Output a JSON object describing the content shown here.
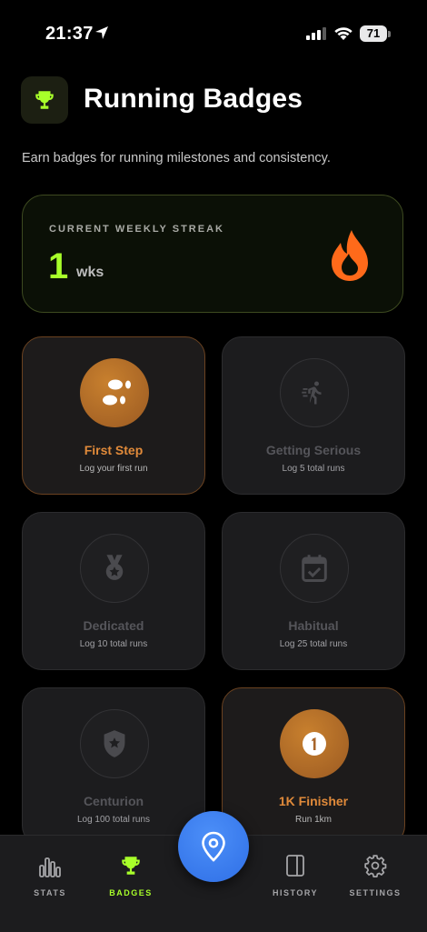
{
  "status_bar": {
    "time": "21:37",
    "battery": "71"
  },
  "header": {
    "title": "Running Badges",
    "subtitle": "Earn badges for running milestones and consistency."
  },
  "streak": {
    "label": "CURRENT WEEKLY STREAK",
    "value": "1",
    "unit": "wks"
  },
  "badges": [
    {
      "name": "First Step",
      "desc": "Log your first run",
      "earned": true,
      "icon": "footprints-icon"
    },
    {
      "name": "Getting Serious",
      "desc": "Log 5 total runs",
      "earned": false,
      "icon": "runner-icon"
    },
    {
      "name": "Dedicated",
      "desc": "Log 10 total runs",
      "earned": false,
      "icon": "medal-icon"
    },
    {
      "name": "Habitual",
      "desc": "Log 25 total runs",
      "earned": false,
      "icon": "calendar-check-icon"
    },
    {
      "name": "Centurion",
      "desc": "Log 100 total runs",
      "earned": false,
      "icon": "shield-star-icon"
    },
    {
      "name": "1K Finisher",
      "desc": "Run 1km",
      "earned": true,
      "icon": "number-one-icon"
    }
  ],
  "tabs": [
    {
      "label": "STATS",
      "icon": "bar-chart-icon",
      "active": false
    },
    {
      "label": "BADGES",
      "icon": "trophy-icon",
      "active": true
    },
    {
      "label": "HISTORY",
      "icon": "book-icon",
      "active": false
    },
    {
      "label": "SETTINGS",
      "icon": "gear-icon",
      "active": false
    }
  ],
  "colors": {
    "accent": "#a8ff2a",
    "earned": "#e08a3a",
    "fab": "#3b7cf0",
    "flame": "#ff6a1a"
  }
}
